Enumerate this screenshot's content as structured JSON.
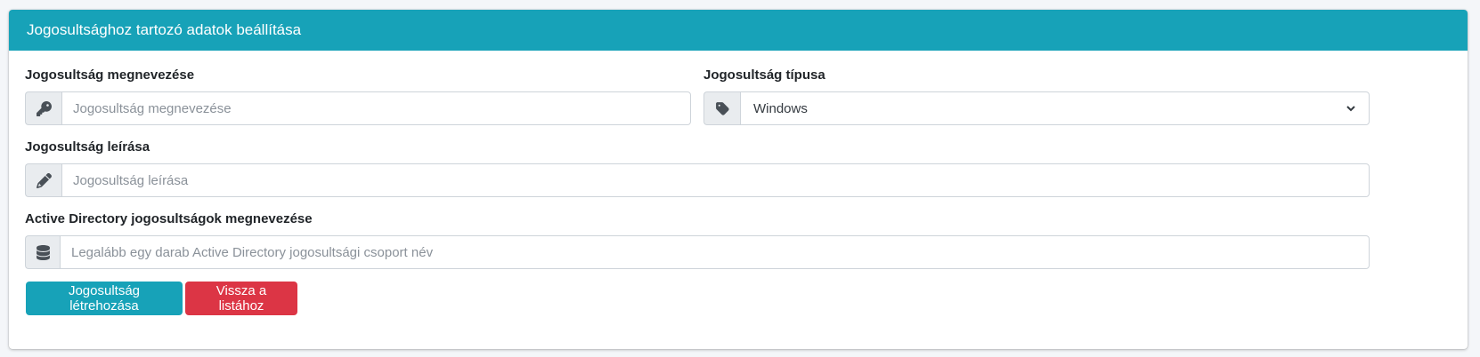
{
  "card": {
    "title": "Jogosultsághoz tartozó adatok beállítása"
  },
  "colors": {
    "header_bg": "#17a2b8",
    "primary_button": "#17a2b8",
    "danger_button": "#dc3545"
  },
  "fields": {
    "name": {
      "label": "Jogosultság megnevezése",
      "placeholder": "Jogosultság megnevezése",
      "value": "",
      "icon": "key-icon"
    },
    "type": {
      "label": "Jogosultság típusa",
      "selected": "Windows",
      "icon": "tag-icon"
    },
    "description": {
      "label": "Jogosultság leírása",
      "placeholder": "Jogosultság leírása",
      "value": "",
      "icon": "pencil-icon"
    },
    "ad_groups": {
      "label": "Active Directory jogosultságok megnevezése",
      "placeholder": "Legalább egy darab Active Directory jogosultsági csoport név",
      "value": "",
      "icon": "database-icon"
    }
  },
  "buttons": {
    "create": "Jogosultság létrehozása",
    "back": "Vissza a listához"
  }
}
